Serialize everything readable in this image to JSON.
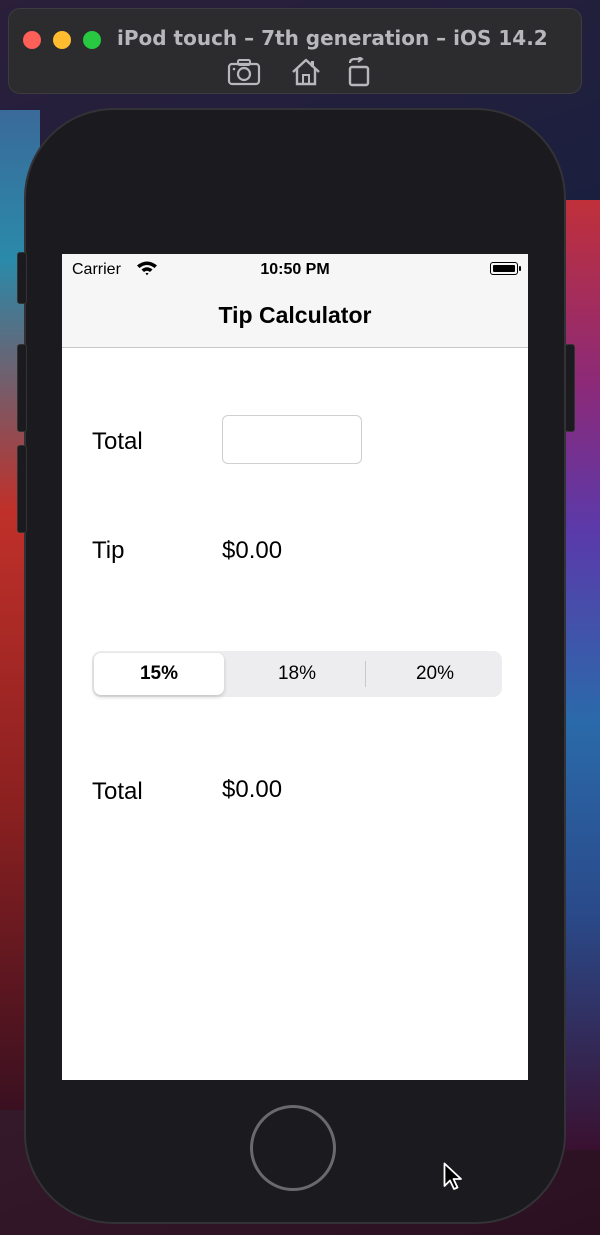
{
  "simulator": {
    "title": "iPod touch – 7th generation – iOS 14.2",
    "tools": [
      "camera-icon",
      "home-icon",
      "rotate-icon"
    ]
  },
  "status_bar": {
    "carrier": "Carrier",
    "time": "10:50 PM",
    "battery_level": 1.0
  },
  "nav": {
    "title": "Tip Calculator"
  },
  "form": {
    "total_label": "Total",
    "total_value": "",
    "tip_label": "Tip",
    "tip_value": "$0.00",
    "grand_total_label": "Total",
    "grand_total_value": "$0.00"
  },
  "segmented": {
    "options": [
      "15%",
      "18%",
      "20%"
    ],
    "selected_index": 0
  },
  "colors": {
    "traffic_red": "#fe5f57",
    "traffic_yellow": "#febc2e",
    "traffic_green": "#28c840"
  }
}
